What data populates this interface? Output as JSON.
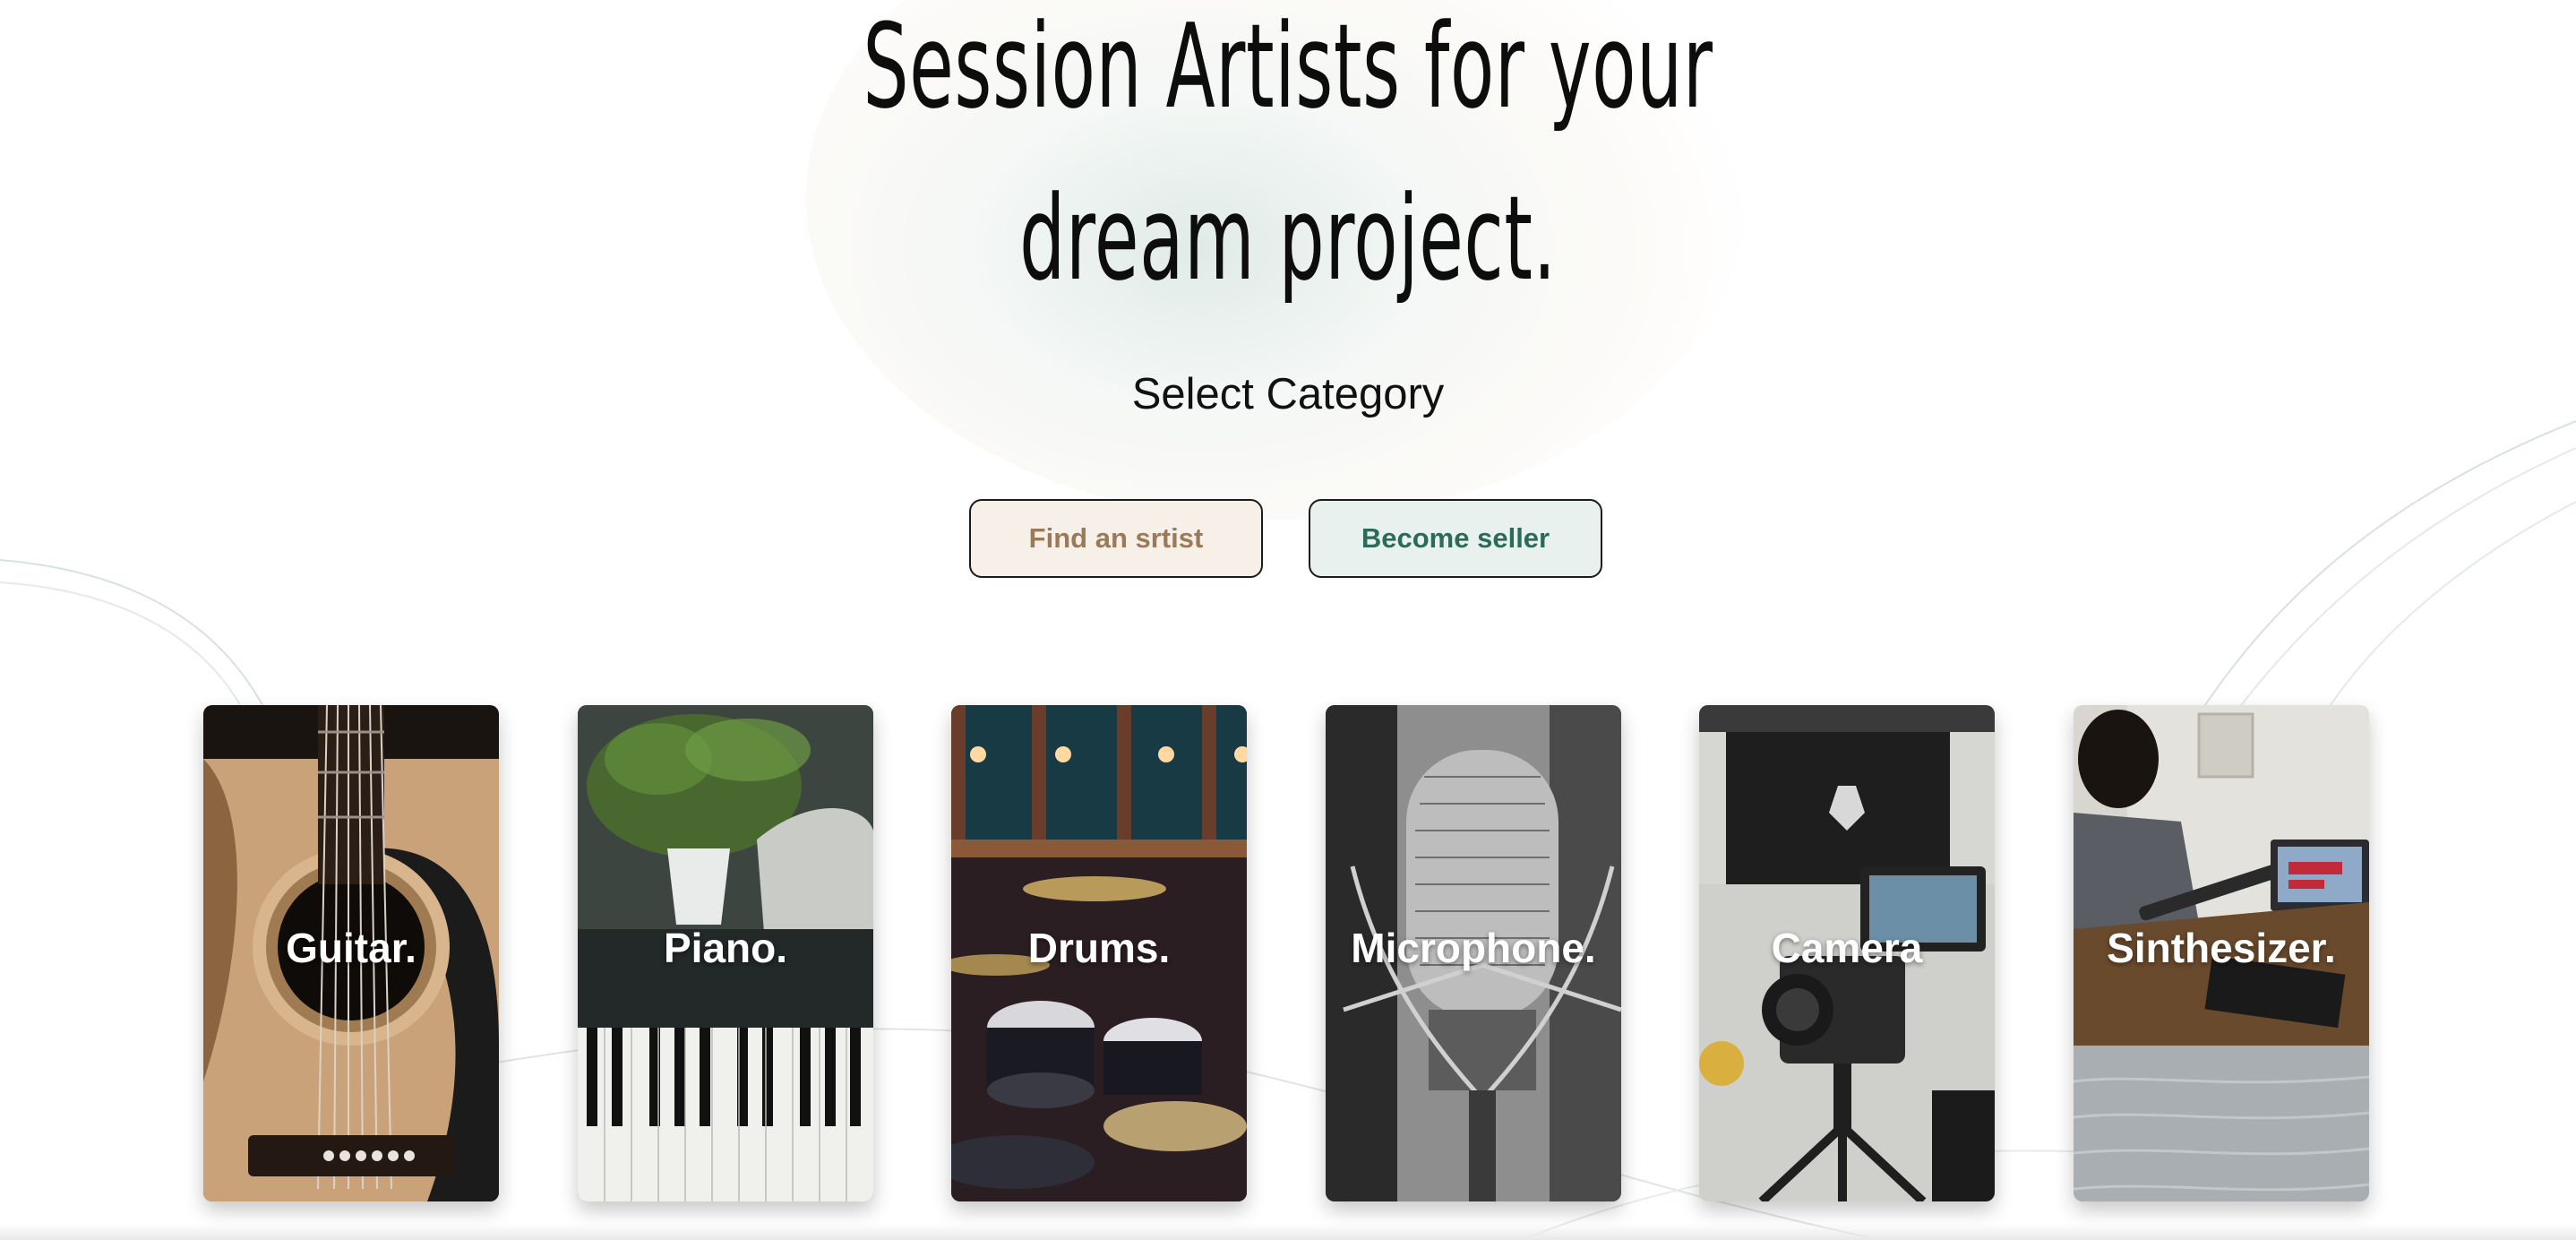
{
  "hero": {
    "title_line1": "Session Artists for your",
    "title_line2": "dream project.",
    "subtitle": "Select Category"
  },
  "actions": {
    "find_artist": "Find an srtist",
    "become_seller": "Become seller"
  },
  "categories": [
    {
      "label": "Guitar.",
      "image": "acoustic-guitar-photo"
    },
    {
      "label": "Piano.",
      "image": "piano-keys-photo"
    },
    {
      "label": "Drums.",
      "image": "drum-kit-photo"
    },
    {
      "label": "Microphone.",
      "image": "studio-microphone-photo"
    },
    {
      "label": "Camera",
      "image": "video-camera-photo"
    },
    {
      "label": "Sinthesizer.",
      "image": "synthesizer-player-photo"
    }
  ],
  "colors": {
    "find_bg": "#f7f0e9",
    "find_text": "#9a7a57",
    "seller_bg": "#e9f1ef",
    "seller_text": "#2b6b5a"
  }
}
